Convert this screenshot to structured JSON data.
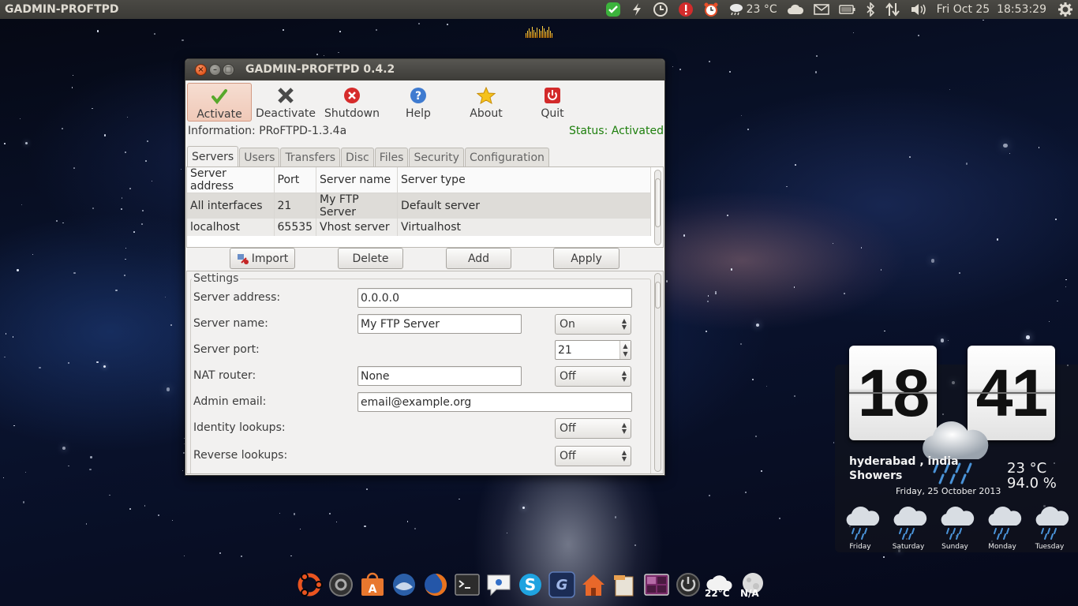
{
  "topbar": {
    "app_title": "GADMIN-PROFTPD",
    "weather_temp": "23 °C",
    "clock": "Fri Oct 25  18:53:29"
  },
  "window": {
    "title": "GADMIN-PROFTPD 0.4.2",
    "toolbar": {
      "activate": "Activate",
      "deactivate": "Deactivate",
      "shutdown": "Shutdown",
      "help": "Help",
      "about": "About",
      "quit": "Quit"
    },
    "information": "Information: PRoFTPD-1.3.4a",
    "status": "Status: Activated",
    "tabs": [
      "Servers",
      "Users",
      "Transfers",
      "Disc",
      "Files",
      "Security",
      "Configuration"
    ],
    "servers": {
      "columns": [
        "Server address",
        "Port",
        "Server name",
        "Server type"
      ],
      "rows": [
        [
          "All interfaces",
          "21",
          "My FTP Server",
          "Default server"
        ],
        [
          "localhost",
          "65535",
          "Vhost server",
          "Virtualhost"
        ]
      ]
    },
    "buttons": {
      "import": "Import",
      "delete": "Delete",
      "add": "Add",
      "apply": "Apply"
    },
    "settings": {
      "legend": "Settings",
      "server_address_label": "Server address:",
      "server_address_value": "0.0.0.0",
      "server_name_label": "Server name:",
      "server_name_value": "My FTP Server",
      "server_name_toggle": "On",
      "server_port_label": "Server port:",
      "server_port_value": "21",
      "nat_router_label": "NAT router:",
      "nat_router_value": "None",
      "nat_router_toggle": "Off",
      "admin_email_label": "Admin email:",
      "admin_email_value": "email@example.org",
      "identity_lookups_label": "Identity lookups:",
      "identity_lookups_value": "Off",
      "reverse_lookups_label": "Reverse lookups:",
      "reverse_lookups_value": "Off"
    }
  },
  "weather_widget": {
    "hours": "18",
    "minutes": "41",
    "location": "hyderabad , india",
    "condition": "Showers",
    "temperature": "23 °C",
    "humidity": "94.0 %",
    "date": "Friday, 25 October 2013",
    "forecast": [
      "Friday",
      "Saturday",
      "Sunday",
      "Monday",
      "Tuesday"
    ]
  },
  "dock": {
    "weather_temp": "22°C",
    "weather_na": "N/A"
  },
  "colors": {
    "status_green": "#1e7f0d",
    "panel": "#3c3b37",
    "window_bg": "#f2f1f0",
    "close_button": "#e2571d",
    "active_button": "#f0c9b8"
  }
}
